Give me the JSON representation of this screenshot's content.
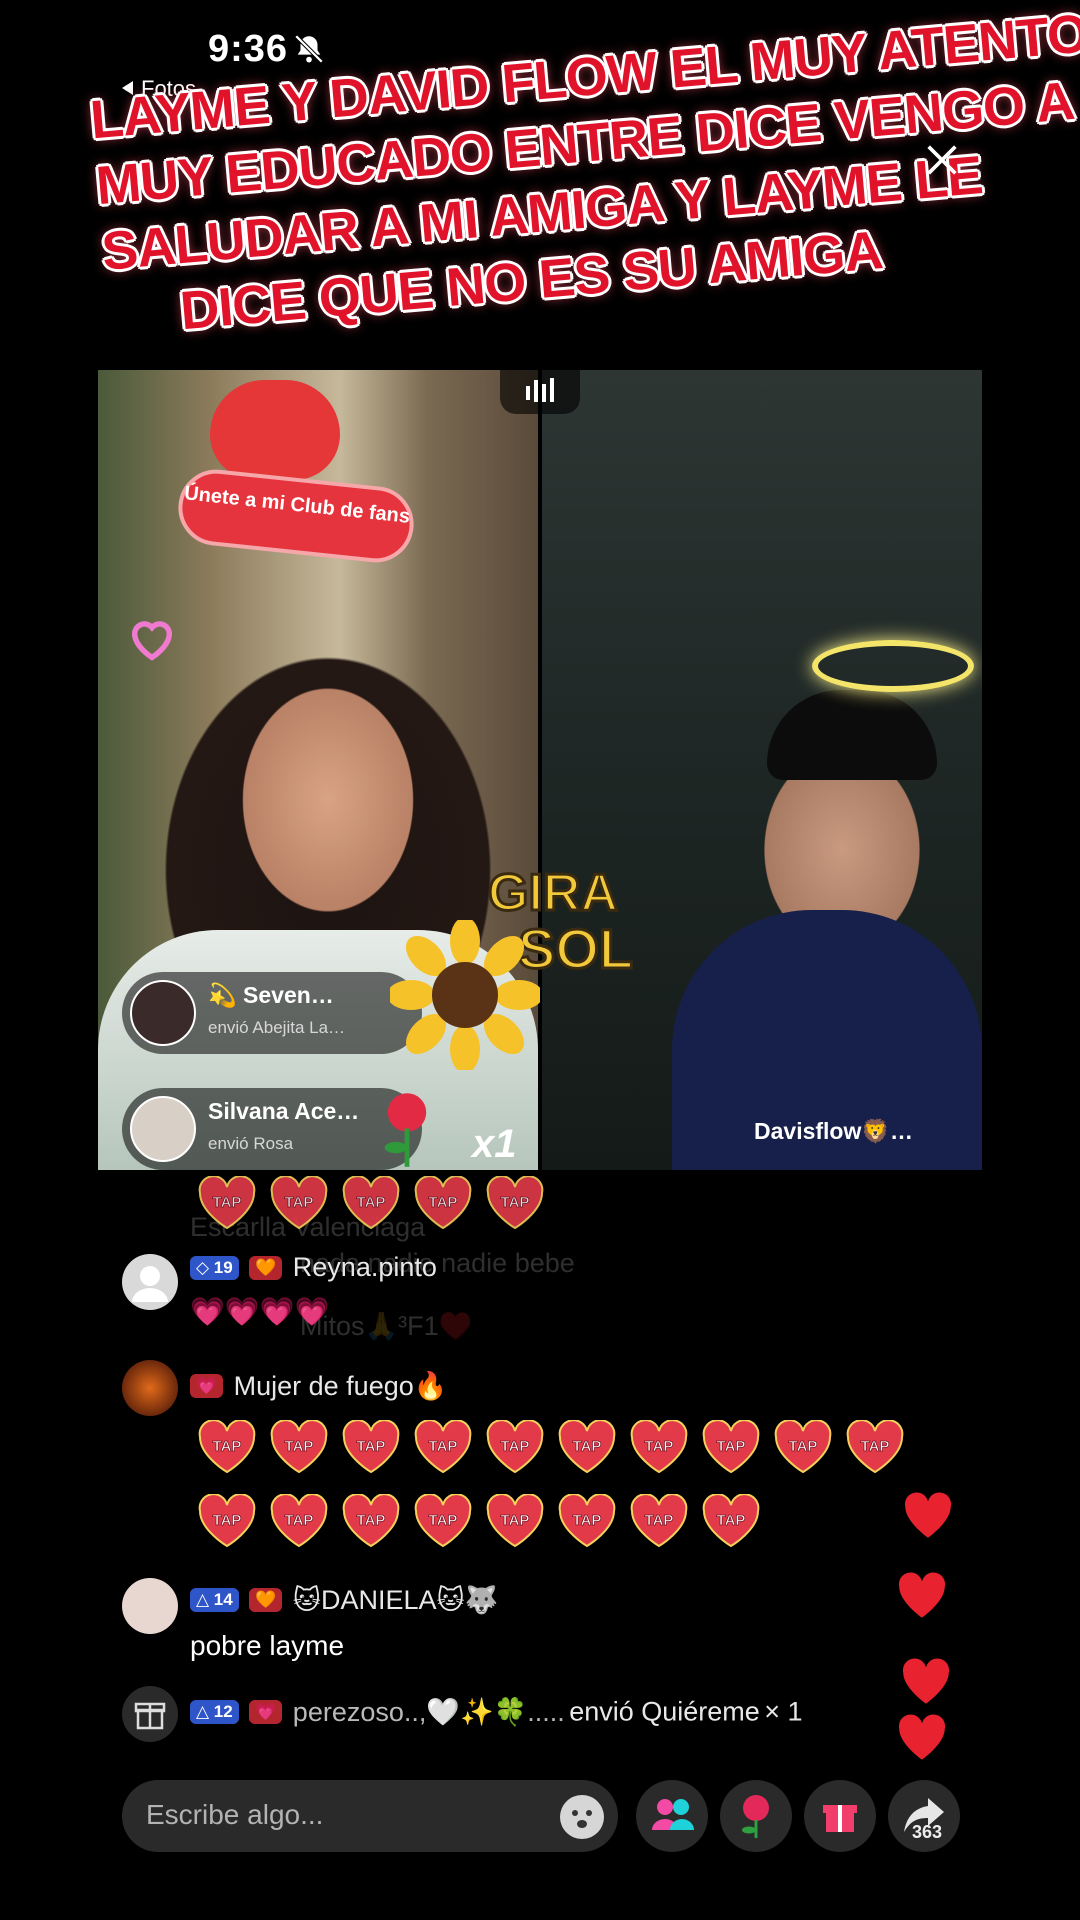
{
  "status_bar": {
    "time": "9:36",
    "back_label": "Fotos"
  },
  "caption": {
    "lines": [
      "Layme y David flow el muy atento",
      "Muy educado entre dice vengo a",
      "saludar a mi amiga y Layme le",
      "dice que no es su amiga"
    ]
  },
  "left_stream": {
    "fanclub_label": "Únete a mi Club de fans"
  },
  "right_stream": {
    "host_name": "Davisflow🦁…",
    "sticker": "GIRA SOL"
  },
  "gifts": [
    {
      "name": "💫 Seven…",
      "detail": "envió Abejita La…"
    },
    {
      "name": "Silvana Ace…",
      "detail": "envió Rosa",
      "count": "x1"
    }
  ],
  "chat": [
    {
      "level": "19",
      "badge": "🧡",
      "user": "Reyna.pinto",
      "message": "💗💗💗💗"
    },
    {
      "badge": "💗",
      "user": "Mujer de fuego🔥",
      "message": ""
    },
    {
      "level": "14",
      "badge": "🧡",
      "user": "🐱DANIELA🐱🐺",
      "message": "pobre layme"
    },
    {
      "level": "12",
      "badge": "💗",
      "user": "perezoso..,🤍✨🍀.....",
      "message": "envió Quiéreme",
      "count": "× 1"
    }
  ],
  "ghost_texts": [
    "Escarlla Valenciaga",
    "nada nadie nadie bebe",
    "Mitos🙏³F1♥️"
  ],
  "tap_label": "TAP",
  "input": {
    "placeholder": "Escribe algo..."
  },
  "share_count": "363",
  "colors": {
    "accent_red": "#e0132b",
    "heart": "#e8232f",
    "badge_blue": "#2f56c8"
  }
}
